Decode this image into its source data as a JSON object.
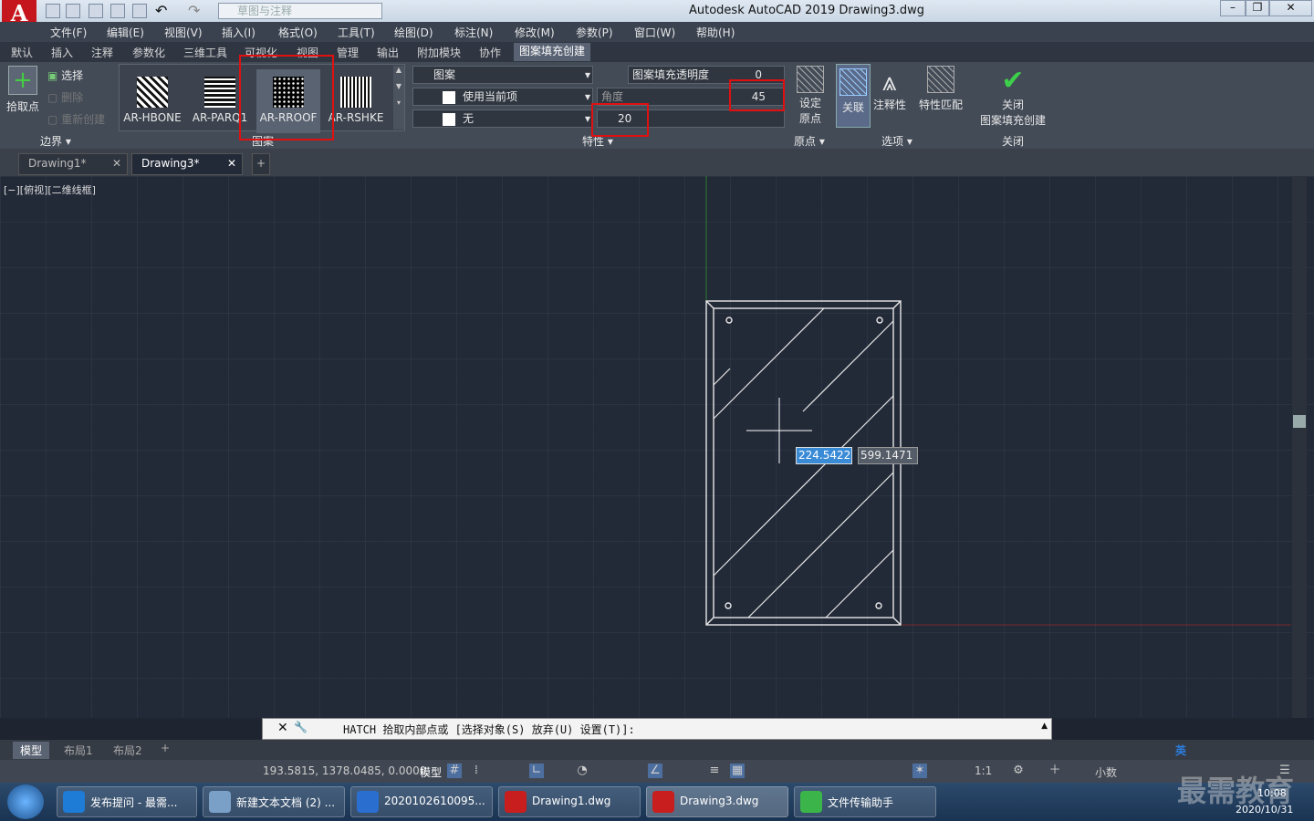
{
  "window": {
    "title": "Autodesk AutoCAD 2019    Drawing3.dwg",
    "workspace": "草图与注释"
  },
  "menu": [
    "文件(F)",
    "编辑(E)",
    "视图(V)",
    "插入(I)",
    "格式(O)",
    "工具(T)",
    "绘图(D)",
    "标注(N)",
    "修改(M)",
    "参数(P)",
    "窗口(W)",
    "帮助(H)"
  ],
  "ribbon_tabs": [
    "默认",
    "插入",
    "注释",
    "参数化",
    "三维工具",
    "可视化",
    "视图",
    "管理",
    "输出",
    "附加模块",
    "协作",
    "图案填充创建"
  ],
  "ribbon": {
    "boundary": {
      "pick_point": "拾取点",
      "select": "选择",
      "remove": "删除",
      "recreate": "重新创建",
      "panel": "边界"
    },
    "patterns": [
      "AR-HBONE",
      "AR-PARQ1",
      "AR-RROOF",
      "AR-RSHKE"
    ],
    "pattern_panel": "图案",
    "props": {
      "type": "图案",
      "color": "使用当前项",
      "background": "无",
      "transparency_label": "图案填充透明度",
      "transparency": "0",
      "angle_label": "角度",
      "angle": "45",
      "scale": "20",
      "panel": "特性"
    },
    "origin": {
      "set": "设定\n原点",
      "panel": "原点"
    },
    "options": {
      "assoc": "关联",
      "annotative": "注释性",
      "match": "特性匹配",
      "panel": "选项"
    },
    "close": {
      "label": "关闭\n图案填充创建",
      "panel": "关闭"
    }
  },
  "doc_tabs": [
    "Drawing1*",
    "Drawing3*"
  ],
  "viewport_label": "[−][俯视][二维线框]",
  "cursor": {
    "x": "224.5422",
    "y": "599.1471"
  },
  "command": {
    "text": "HATCH 拾取内部点或 [选择对象(S) 放弃(U) 设置(T)]:"
  },
  "layouts": [
    "模型",
    "布局1",
    "布局2"
  ],
  "status": {
    "coords": "193.5815, 1378.0485, 0.0000",
    "model": "模型",
    "scale": "1:1",
    "units": "小数"
  },
  "taskbar": [
    {
      "label": "发布提问 - 最需...",
      "color": "#1e7bd6"
    },
    {
      "label": "新建文本文档 (2) ...",
      "color": "#7aa0c8"
    },
    {
      "label": "2020102610095...",
      "color": "#2a6fd0"
    },
    {
      "label": "Drawing1.dwg",
      "color": "#c81e1e"
    },
    {
      "label": "Drawing3.dwg",
      "color": "#c81e1e"
    },
    {
      "label": "文件传输助手",
      "color": "#3bb54a"
    }
  ],
  "tray": {
    "time": "10:08",
    "date": "2020/10/31",
    "ime": "英"
  },
  "watermark": "最需教育"
}
